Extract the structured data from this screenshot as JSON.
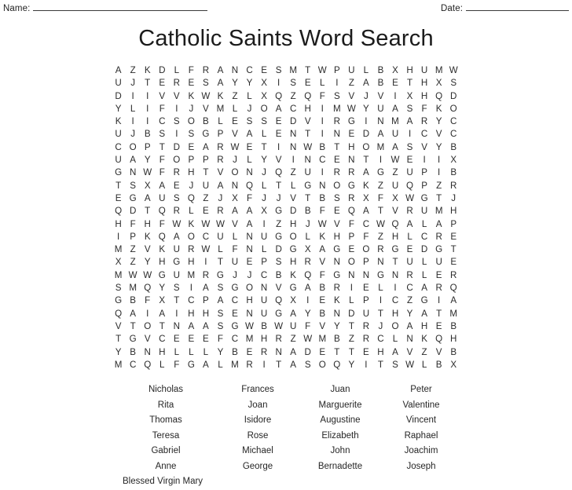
{
  "header": {
    "name_label": "Name:",
    "date_label": "Date:"
  },
  "title": "Catholic Saints Word Search",
  "grid": {
    "rows": 23,
    "cols": 20,
    "letters": [
      "A Z K D L F R A N C E S M T W P U L B X H U M W",
      "U J T E R E S A Y Y X I S E L I Z A B E T H X S",
      "D I I V V K W K Z L X Q Z Q F S V J V I X H Q D",
      "Y L I F I J V M L J O A C H I M W Y U A S F K O",
      "K I I C S O B L E S S E D V I R G I N M A R Y C",
      "U J B S I S G P V A L E N T I N E D A U I C V C",
      "C O P T D E A R W E T I N W B T H O M A S V Y B",
      "U A Y F O P P R J L Y V I N C E N T I W E I I X",
      "G N W F R H T V O N J Q Z U I R R A G Z U P I B",
      "T S X A E J U A N Q L T L G N O G K Z U Q P Z R",
      "E G A U S Q Z J X F J J V T B S R X F X W G T J",
      "Q D T Q R L E R A A X G D B F E Q A T V R U M H",
      "H F H F W K W W V A I Z H J W V F C W Q A L A P",
      "I P K Q A O C U L N U G O L K H P F Z H L C R E",
      "M Z V K U R W L F N L D G X A G E O R G E D G T",
      "X Z Y H G H I T U E P S H R V N O P N T U L U E",
      "M W W G U M R G J J C B K Q F G N N G N R L E R",
      "S M Q Y S I A S G O N V G A B R I E L I C A R Q",
      "G B F X T C P A C H U Q X I E K L P I C Z G I A",
      "Q A I A I H H S E N U G A Y B N D U T H Y A T M",
      "V T O T N A A S G W B W U F V Y T R J O A H E B",
      "T G V C E E E F C M H R Z W M B Z R C L N K Q H",
      "Y B N H L L L Y B E R N A D E T T E H A V Z V B",
      "M C Q L F G A L M R I T A S O Q Y I T S W L B X"
    ]
  },
  "wordlist": {
    "rows": [
      [
        "Nicholas",
        "Frances",
        "Juan",
        "Peter"
      ],
      [
        "Rita",
        "Joan",
        "Marguerite",
        "Valentine"
      ],
      [
        "Thomas",
        "Isidore",
        "Augustine",
        "Vincent"
      ],
      [
        "Teresa",
        "Rose",
        "Elizabeth",
        "Raphael"
      ],
      [
        "Gabriel",
        "Michael",
        "John",
        "Joachim"
      ],
      [
        "Anne",
        "George",
        "Bernadette",
        "Joseph"
      ]
    ],
    "last_row": [
      "Blessed Virgin Mary"
    ]
  }
}
